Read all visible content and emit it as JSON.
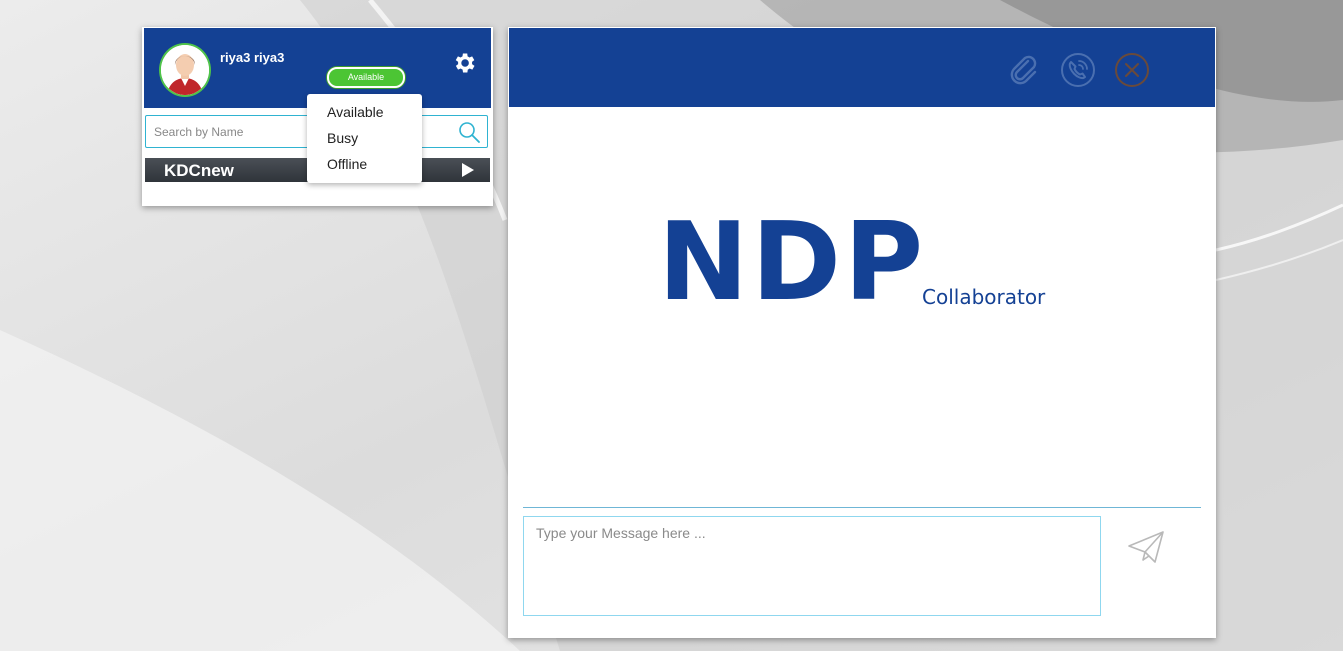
{
  "user": {
    "name": "riya3 riya3",
    "status": "Available"
  },
  "search": {
    "placeholder": "Search by Name"
  },
  "contacts": [
    {
      "name": "KDCnew"
    }
  ],
  "status_menu": {
    "options": [
      "Available",
      "Busy",
      "Offline"
    ]
  },
  "chat": {
    "logo_main": "NDP",
    "logo_sub": "Collaborator",
    "message_placeholder": "Type your Message here ..."
  },
  "icons": {
    "settings": "gear-icon",
    "search": "search-icon",
    "open_contact": "play-icon",
    "attach": "paperclip-icon",
    "call": "phone-icon",
    "close": "close-icon",
    "send": "send-icon"
  },
  "colors": {
    "brand_blue": "#144194",
    "status_green": "#4cc534",
    "contact_bar": "#3a3f45",
    "accent_cyan": "#2fb3d1"
  }
}
